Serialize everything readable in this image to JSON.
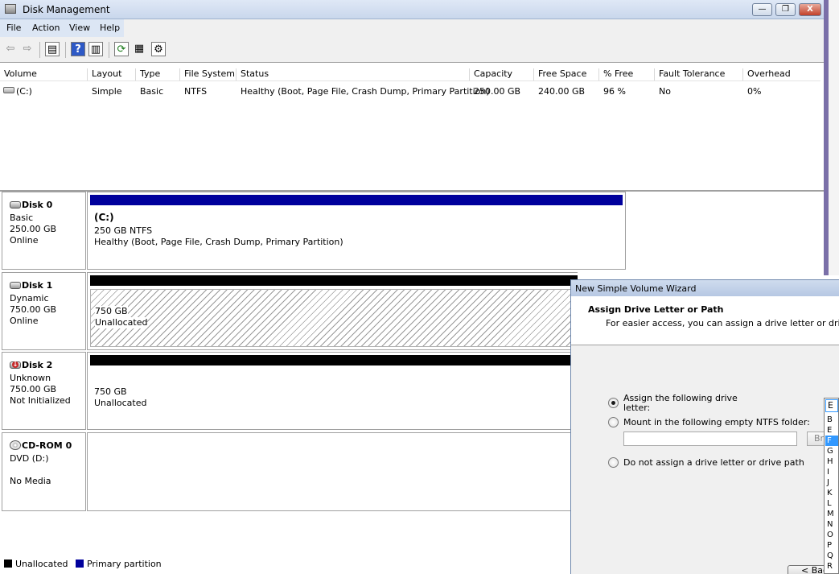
{
  "window": {
    "title": "Disk Management",
    "min_label": "—",
    "max_label": "❐",
    "close_label": "X"
  },
  "menu": {
    "file": "File",
    "action": "Action",
    "view": "View",
    "help": "Help"
  },
  "toolbar": {
    "back": "⇦",
    "forward": "⇨",
    "grid": "▤",
    "help": "?",
    "panel": "▥",
    "refresh": "⟳",
    "props": "▦",
    "settings": "⚙"
  },
  "columns": [
    "Volume",
    "Layout",
    "Type",
    "File System",
    "Status",
    "Capacity",
    "Free Space",
    "% Free",
    "Fault Tolerance",
    "Overhead"
  ],
  "volumes": [
    {
      "volume": "(C:)",
      "layout": "Simple",
      "type": "Basic",
      "fs": "NTFS",
      "status": "Healthy (Boot, Page File, Crash Dump, Primary Partition)",
      "capacity": "250.00 GB",
      "free": "240.00 GB",
      "pct": "96 %",
      "fault": "No",
      "overhead": "0%"
    }
  ],
  "disks": [
    {
      "name": "Disk 0",
      "type": "Basic",
      "size": "250.00 GB",
      "state": "Online",
      "part_title": "(C:)",
      "part_size": "250 GB NTFS",
      "part_status": "Healthy (Boot, Page File, Crash Dump, Primary Partition)"
    },
    {
      "name": "Disk 1",
      "type": "Dynamic",
      "size": "750.00 GB",
      "state": "Online",
      "part_size": "750 GB",
      "part_status": "Unallocated"
    },
    {
      "name": "Disk 2",
      "type": "Unknown",
      "size": "750.00 GB",
      "state": "Not Initialized",
      "part_size": "750 GB",
      "part_status": "Unallocated"
    },
    {
      "name": "CD-ROM 0",
      "type": "DVD (D:)",
      "state": "No Media"
    }
  ],
  "legend": {
    "unallocated": "Unallocated",
    "primary": "Primary partition"
  },
  "colors": {
    "primary": "#00009c",
    "unallocated": "#000000",
    "title_bar": "#c9d7ec",
    "selection": "#3399ff"
  },
  "wizard": {
    "title": "New Simple Volume Wizard",
    "heading": "Assign Drive Letter or Path",
    "subheading": "For easier access, you can assign a drive letter or drive path",
    "opt_assign_1": "Assign the following drive",
    "opt_assign_2": "letter:",
    "opt_mount": "Mount in the following empty NTFS folder:",
    "folder_value": "",
    "browse": "Bro",
    "opt_none": "Do not assign a drive letter or drive path",
    "back": "< Back"
  },
  "drive_letter": {
    "selected": "E",
    "options": [
      "B",
      "E",
      "F",
      "G",
      "H",
      "I",
      "J",
      "K",
      "L",
      "M",
      "N",
      "O",
      "P",
      "Q",
      "R"
    ],
    "highlighted": "F"
  }
}
